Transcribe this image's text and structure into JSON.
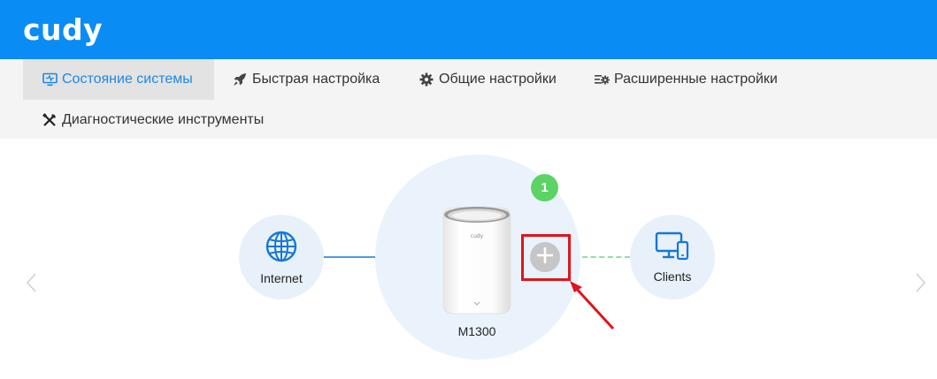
{
  "brand": {
    "logo": "cudy",
    "header_color": "#0a8cf5",
    "accent_color": "#1e88e5"
  },
  "nav": {
    "tabs": [
      {
        "label": "Состояние системы",
        "icon": "monitor-icon",
        "active": true
      },
      {
        "label": "Быстрая настройка",
        "icon": "rocket-icon",
        "active": false
      },
      {
        "label": "Общие настройки",
        "icon": "gear-icon",
        "active": false
      },
      {
        "label": "Расширенные настройки",
        "icon": "advanced-settings-icon",
        "active": false
      },
      {
        "label": "Диагностические инструменты",
        "icon": "tools-icon",
        "active": false
      }
    ]
  },
  "topology": {
    "internet_label": "Internet",
    "internet_icon": "globe-icon",
    "device_label": "M1300",
    "device_badge": "1",
    "add_icon": "plus-icon",
    "clients_label": "Clients",
    "clients_icon": "devices-icon",
    "highlight_color": "#e0141b"
  }
}
